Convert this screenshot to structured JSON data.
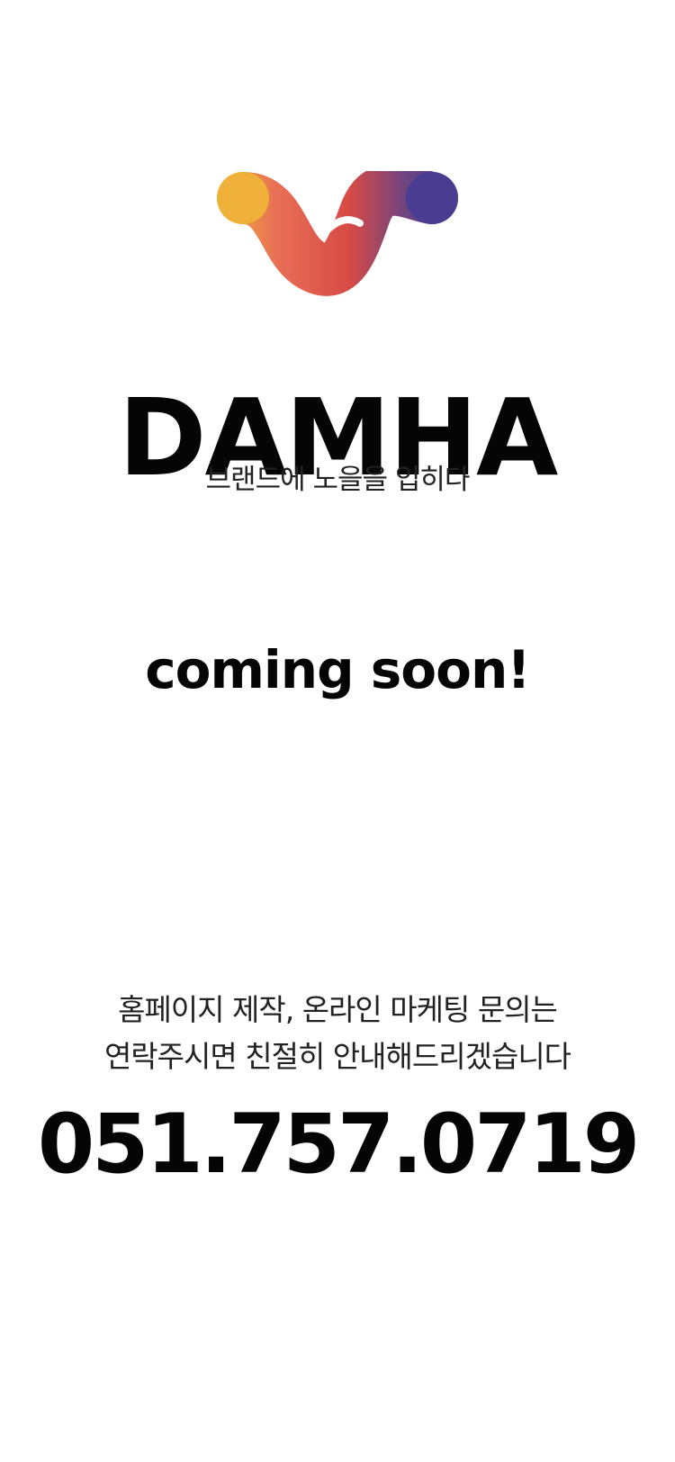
{
  "brand": {
    "logo_icon": "damha-wave-logo-icon",
    "name": "DAMHA",
    "tagline": "브랜드에 노을을 입히다"
  },
  "status": {
    "headline": "coming soon!"
  },
  "contact": {
    "message_line_1": "홈페이지 제작, 온라인 마케팅 문의는",
    "message_line_2": "연락주시면 친절히 안내해드리겠습니다",
    "phone": "051.757.0719"
  },
  "colors": {
    "background": "#ffffff",
    "text": "#050505",
    "logo_gradient": [
      "#efb139",
      "#e86f56",
      "#d74a45",
      "#6d4480",
      "#4a3d91"
    ]
  }
}
